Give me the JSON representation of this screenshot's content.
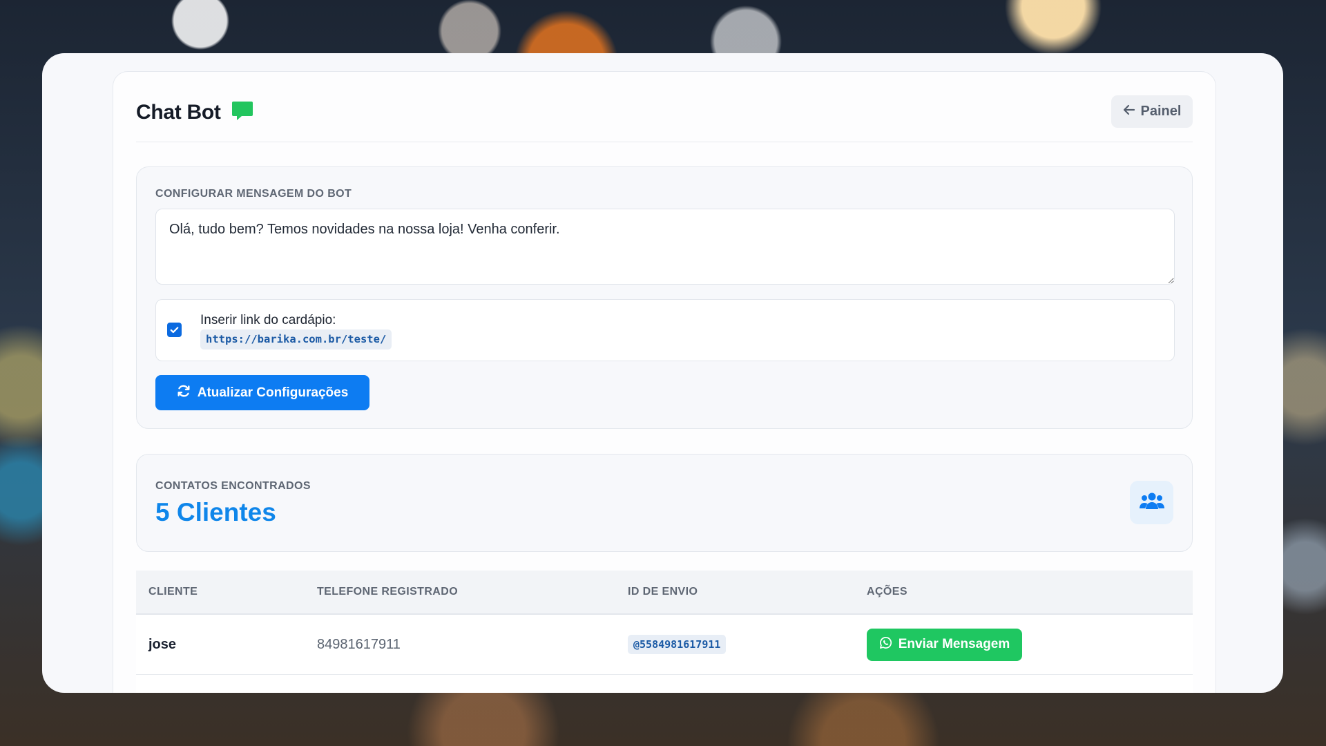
{
  "header": {
    "title": "Chat Bot",
    "back_label": "Painel"
  },
  "config": {
    "section_label": "CONFIGURAR MENSAGEM DO BOT",
    "message": "Olá, tudo bem? Temos novidades na nossa loja! Venha conferir.",
    "link_checkbox_checked": true,
    "link_label": "Inserir link do cardápio:",
    "link_url": "https://barika.com.br/teste/",
    "update_label": "Atualizar Configurações"
  },
  "contacts": {
    "section_label": "CONTATOS ENCONTRADOS",
    "count_text": "5 Clientes"
  },
  "table": {
    "headers": [
      "CLIENTE",
      "TELEFONE REGISTRADO",
      "ID DE ENVIO",
      "AÇÕES"
    ],
    "rows": [
      {
        "name": "jose",
        "phone": "84981617911",
        "send_id": "@5584981617911",
        "action_label": "Enviar Mensagem"
      }
    ]
  },
  "colors": {
    "primary": "#0d7cf2",
    "whatsapp": "#1fc761",
    "accent_text": "#0f86ea"
  },
  "icons": {
    "title": "chat-bubble-icon",
    "back": "arrow-left-icon",
    "update": "sync-icon",
    "contacts": "users-icon",
    "send": "whatsapp-icon"
  }
}
